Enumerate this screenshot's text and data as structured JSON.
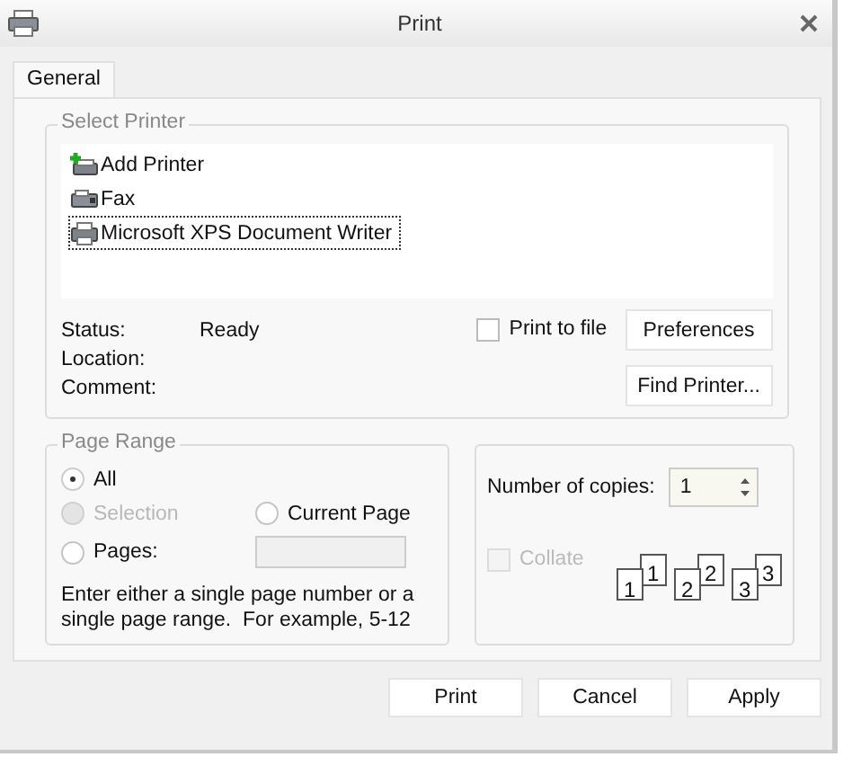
{
  "window": {
    "title": "Print"
  },
  "tabs": [
    {
      "label": "General",
      "selected": true
    }
  ],
  "select_printer": {
    "title": "Select Printer",
    "printers": [
      {
        "name": "Add Printer",
        "kind": "add",
        "selected": false
      },
      {
        "name": "Fax",
        "kind": "fax",
        "selected": false
      },
      {
        "name": "Microsoft XPS Document Writer",
        "kind": "printer",
        "selected": true
      }
    ],
    "status": [
      {
        "label": "Status:",
        "value": "Ready"
      },
      {
        "label": "Location:"
      },
      {
        "label": "Comment:"
      }
    ],
    "print_to_file": {
      "label": "Print to file",
      "checked": false
    },
    "buttons": [
      "Preferences",
      "Find Printer..."
    ]
  },
  "page_range": {
    "title": "Page Range",
    "options": [
      {
        "label": "All",
        "selected": true,
        "disabled": false
      },
      {
        "label": "Selection",
        "selected": false,
        "disabled": true
      },
      {
        "label": "Current Page",
        "selected": false,
        "disabled": false
      },
      {
        "label": "Pages:",
        "selected": false,
        "disabled": false
      }
    ],
    "pages_field": {
      "disabled": true
    },
    "hint": "Enter either a single page number or a single page range.  For example, 5-12"
  },
  "copies": {
    "label": "Number of copies:",
    "value": "1",
    "collate": {
      "label": "Collate",
      "checked": false,
      "disabled": true
    },
    "stacks": [
      {
        "back": "1",
        "front": "1"
      },
      {
        "back": "2",
        "front": "2"
      },
      {
        "back": "3",
        "front": "3"
      }
    ]
  },
  "buttons": [
    "Print",
    "Cancel",
    "Apply"
  ]
}
